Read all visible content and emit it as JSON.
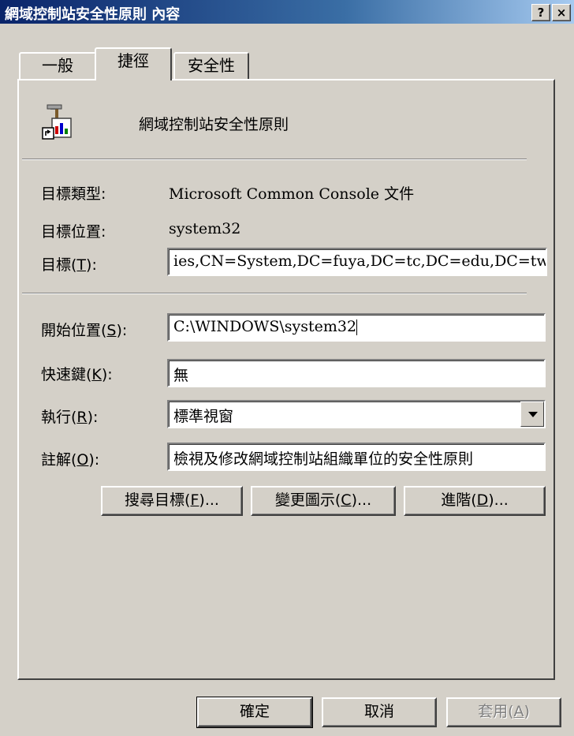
{
  "window": {
    "title": "網域控制站安全性原則 內容",
    "help_label": "?",
    "close_label": "×"
  },
  "tabs": [
    {
      "label": "一般"
    },
    {
      "label": "捷徑"
    },
    {
      "label": "安全性"
    }
  ],
  "header": {
    "name": "網域控制站安全性原則",
    "icon": "mmc-shortcut-icon"
  },
  "info": {
    "target_type_label": "目標類型:",
    "target_type_value": "Microsoft Common Console 文件",
    "target_location_label": "目標位置:",
    "target_location_value": "system32",
    "target_label_pre": "目標(",
    "target_label_key": "T",
    "target_label_post": "):",
    "target_value": "ies,CN=System,DC=fuya,DC=tc,DC=edu,DC=tw\""
  },
  "fields": {
    "start_in_label_pre": "開始位置(",
    "start_in_label_key": "S",
    "start_in_label_post": "):",
    "start_in_value": "C:\\WINDOWS\\system32",
    "shortcut_key_label_pre": "快速鍵(",
    "shortcut_key_label_key": "K",
    "shortcut_key_label_post": "):",
    "shortcut_key_value": "無",
    "run_label_pre": "執行(",
    "run_label_key": "R",
    "run_label_post": "):",
    "run_value": "標準視窗",
    "comment_label_pre": "註解(",
    "comment_label_key": "O",
    "comment_label_post": "):",
    "comment_value": "檢視及修改網域控制站組織單位的安全性原則"
  },
  "actions": {
    "find_target_pre": "搜尋目標(",
    "find_target_key": "F",
    "find_target_post": ")...",
    "change_icon_pre": "變更圖示(",
    "change_icon_key": "C",
    "change_icon_post": ")...",
    "advanced_pre": "進階(",
    "advanced_key": "D",
    "advanced_post": ")..."
  },
  "footer": {
    "ok_label": "確定",
    "cancel_label": "取消",
    "apply_pre": "套用(",
    "apply_key": "A",
    "apply_post": ")"
  }
}
